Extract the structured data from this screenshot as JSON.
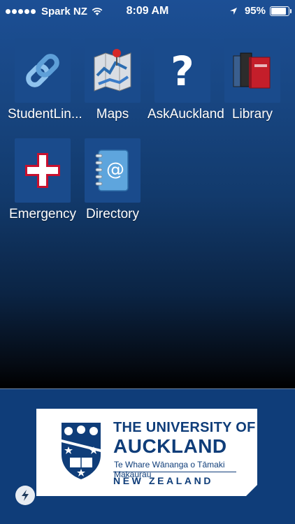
{
  "status_bar": {
    "carrier": "Spark NZ",
    "time": "8:09 AM",
    "battery_text": "95%",
    "battery_level": 0.95
  },
  "apps": [
    {
      "label": "StudentLin...",
      "icon": "link-chain-icon"
    },
    {
      "label": "Maps",
      "icon": "map-pin-icon"
    },
    {
      "label": "AskAuckland",
      "icon": "question-mark-icon"
    },
    {
      "label": "Library",
      "icon": "books-icon"
    },
    {
      "label": "Emergency",
      "icon": "medical-cross-icon"
    },
    {
      "label": "Directory",
      "icon": "address-book-icon"
    }
  ],
  "footer": {
    "logo_line1": "THE UNIVERSITY OF",
    "logo_line2": "AUCKLAND",
    "logo_line3": "Te Whare Wānanga o Tāmaki Makaurau",
    "logo_line4": "NEW ZEALAND"
  },
  "colors": {
    "brand_blue": "#0f3d79",
    "tile_blue": "#1a4b8c",
    "emergency_red": "#c8102e"
  }
}
